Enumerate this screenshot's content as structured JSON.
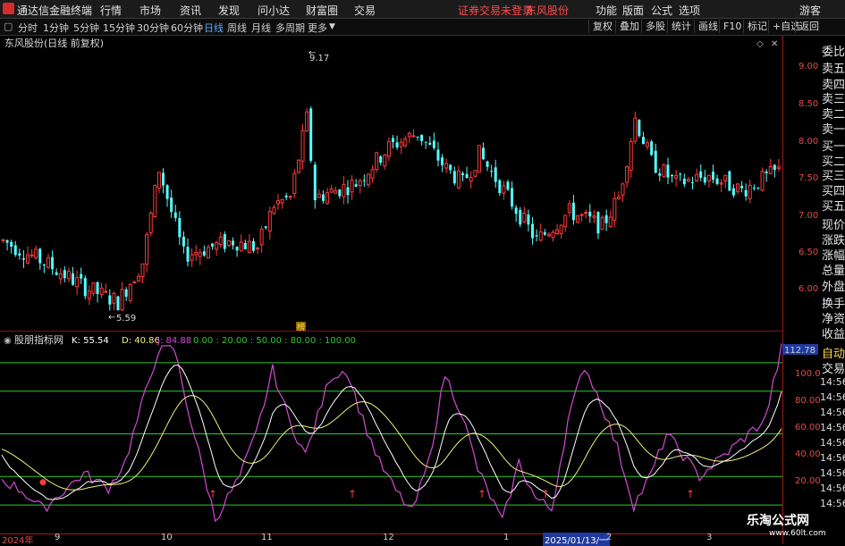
{
  "app": {
    "title": "通达信金融终端",
    "menu": [
      "行情",
      "市场",
      "资讯",
      "发现",
      "问小达",
      "财富圈",
      "交易"
    ],
    "notice": "证券交易未登录",
    "stock": "东风股份",
    "right_menu": [
      "功能",
      "版面",
      "公式",
      "选项"
    ],
    "guest": "游客"
  },
  "toolbar": {
    "periods": [
      "分时",
      "1分钟",
      "5分钟",
      "15分钟",
      "30分钟",
      "60分钟",
      "日线",
      "周线",
      "月线",
      "多周期",
      "更多"
    ],
    "active": "日线",
    "right_buttons": [
      "复权",
      "叠加",
      "多股",
      "统计",
      "画线",
      "F10",
      "标记",
      "+自选",
      "返回"
    ]
  },
  "main_chart": {
    "legend": "东风股份(日线 前复权)",
    "y_ticks": [
      "9.00",
      "8.50",
      "8.00",
      "7.50",
      "7.00",
      "6.50",
      "6.00"
    ],
    "high_label": "9.17",
    "low_label": "5.59",
    "event_marker": "榜"
  },
  "indicator": {
    "name": "股朋指标网",
    "k_label": "K: 55.54",
    "d_label": "D: 40.86",
    "j_label": "J: 84.88",
    "levels_label": "0.00 : 20.00 : 50.00 : 80.00 : 100.00",
    "badge": "112.78",
    "y_ticks": [
      "100.0",
      "80.00",
      "60.00",
      "40.00",
      "20.00"
    ]
  },
  "right_panel": {
    "items": [
      "委比",
      "卖五",
      "卖四",
      "卖三",
      "卖二",
      "卖一",
      "买一",
      "买二",
      "买三",
      "买四",
      "买五",
      "现价",
      "涨跌",
      "涨幅",
      "总量",
      "外盘",
      "换手",
      "净资",
      "收益",
      "自动",
      "交易"
    ],
    "times": [
      "14:56",
      "14:56",
      "14:56",
      "14:56",
      "14:56",
      "14:56",
      "14:56",
      "14:56",
      "14:56"
    ]
  },
  "bottom_axis": {
    "labels": [
      "2024年",
      "9",
      "10",
      "11",
      "12",
      "1",
      "2025/01/13/一",
      "2",
      "3"
    ]
  },
  "watermark": {
    "text": "乐淘公式网",
    "url": "www.60lt.com"
  },
  "colors": {
    "up": "#ff3b3b",
    "down": "#54ffff",
    "k_line": "#ffffff",
    "d_line": "#f1f17a",
    "j_line": "#d44ad4",
    "level_line": "#2fc82f",
    "axis": "#a11a1a"
  }
}
